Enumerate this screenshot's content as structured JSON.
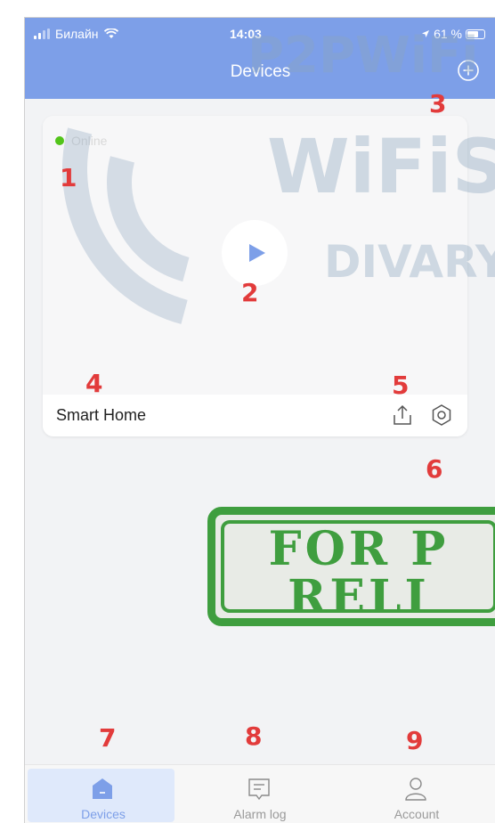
{
  "status_bar": {
    "carrier": "Билайн",
    "time": "14:03",
    "battery": "61 %"
  },
  "header": {
    "title": "Devices"
  },
  "device": {
    "status": "Online",
    "status_color": "#52c41a",
    "name": "Smart Home"
  },
  "tabs": [
    {
      "label": "Devices",
      "icon": "home-icon",
      "active": true
    },
    {
      "label": "Alarm log",
      "icon": "message-icon",
      "active": false
    },
    {
      "label": "Account",
      "icon": "person-icon",
      "active": false
    }
  ],
  "annotations": [
    "1",
    "2",
    "3",
    "4",
    "5",
    "6",
    "7",
    "8",
    "9"
  ],
  "watermarks": {
    "brand_1": "P2PWiFi",
    "brand_2": "WiFiS",
    "brand_3": "DIVARY",
    "stamp_line_1": "FOR P",
    "stamp_line_2": "RELI"
  },
  "colors": {
    "accent": "#7d9fe8",
    "annotation": "#e23b3b",
    "stamp": "#3f9e3f"
  }
}
